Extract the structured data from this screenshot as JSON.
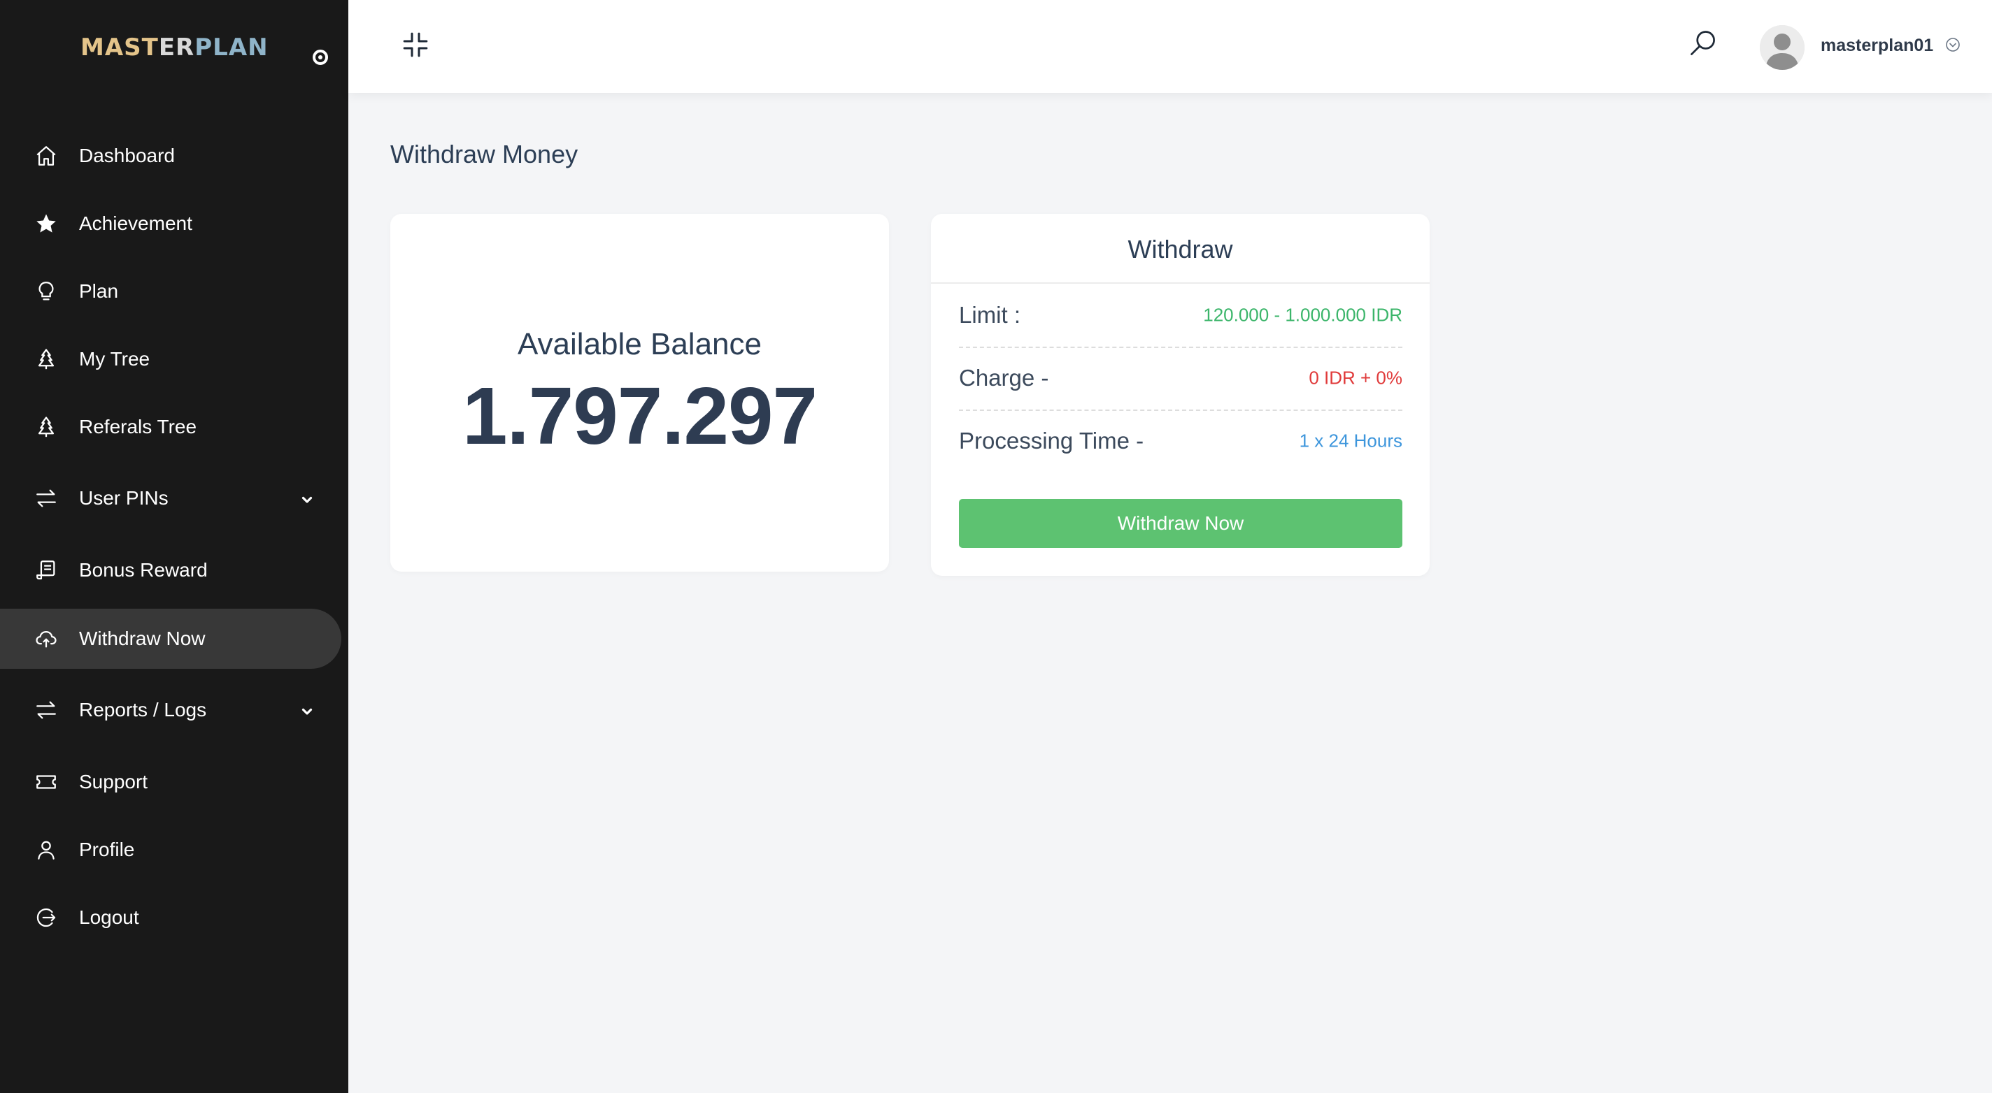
{
  "brand": {
    "part1": "MAST",
    "part2": "ER",
    "part3": "PLAN"
  },
  "sidebar": {
    "items": [
      {
        "label": "Dashboard",
        "icon": "home-icon"
      },
      {
        "label": "Achievement",
        "icon": "star-icon"
      },
      {
        "label": "Plan",
        "icon": "lightbulb-icon"
      },
      {
        "label": "My Tree",
        "icon": "tree-icon"
      },
      {
        "label": "Referals Tree",
        "icon": "tree-icon"
      },
      {
        "label": "User PINs",
        "icon": "transfer-icon",
        "has_submenu": true
      },
      {
        "label": "Bonus Reward",
        "icon": "receipt-icon"
      },
      {
        "label": "Withdraw Now",
        "icon": "cloud-upload-icon",
        "active": true
      },
      {
        "label": "Reports / Logs",
        "icon": "transfer-icon",
        "has_submenu": true
      },
      {
        "label": "Support",
        "icon": "ticket-icon"
      },
      {
        "label": "Profile",
        "icon": "user-icon"
      },
      {
        "label": "Logout",
        "icon": "logout-icon"
      }
    ]
  },
  "header": {
    "username": "masterplan01"
  },
  "page": {
    "title": "Withdraw Money"
  },
  "balance": {
    "label": "Available Balance",
    "value": "1.797.297"
  },
  "withdraw": {
    "title": "Withdraw",
    "rows": [
      {
        "key": "Limit :",
        "value": "120.000 - 1.000.000 IDR",
        "color": "#3bb56a"
      },
      {
        "key": "Charge -",
        "value": "0 IDR + 0%",
        "color": "#e03a3a"
      },
      {
        "key": "Processing Time -",
        "value": "1 x 24 Hours",
        "color": "#3e96dc"
      }
    ],
    "button_label": "Withdraw Now",
    "button_color": "#5dc271"
  },
  "colors": {
    "sidebar_bg": "#191919",
    "active_item_bg": "#383838",
    "content_bg": "#f4f5f7",
    "text_dark": "#2c3e55"
  }
}
